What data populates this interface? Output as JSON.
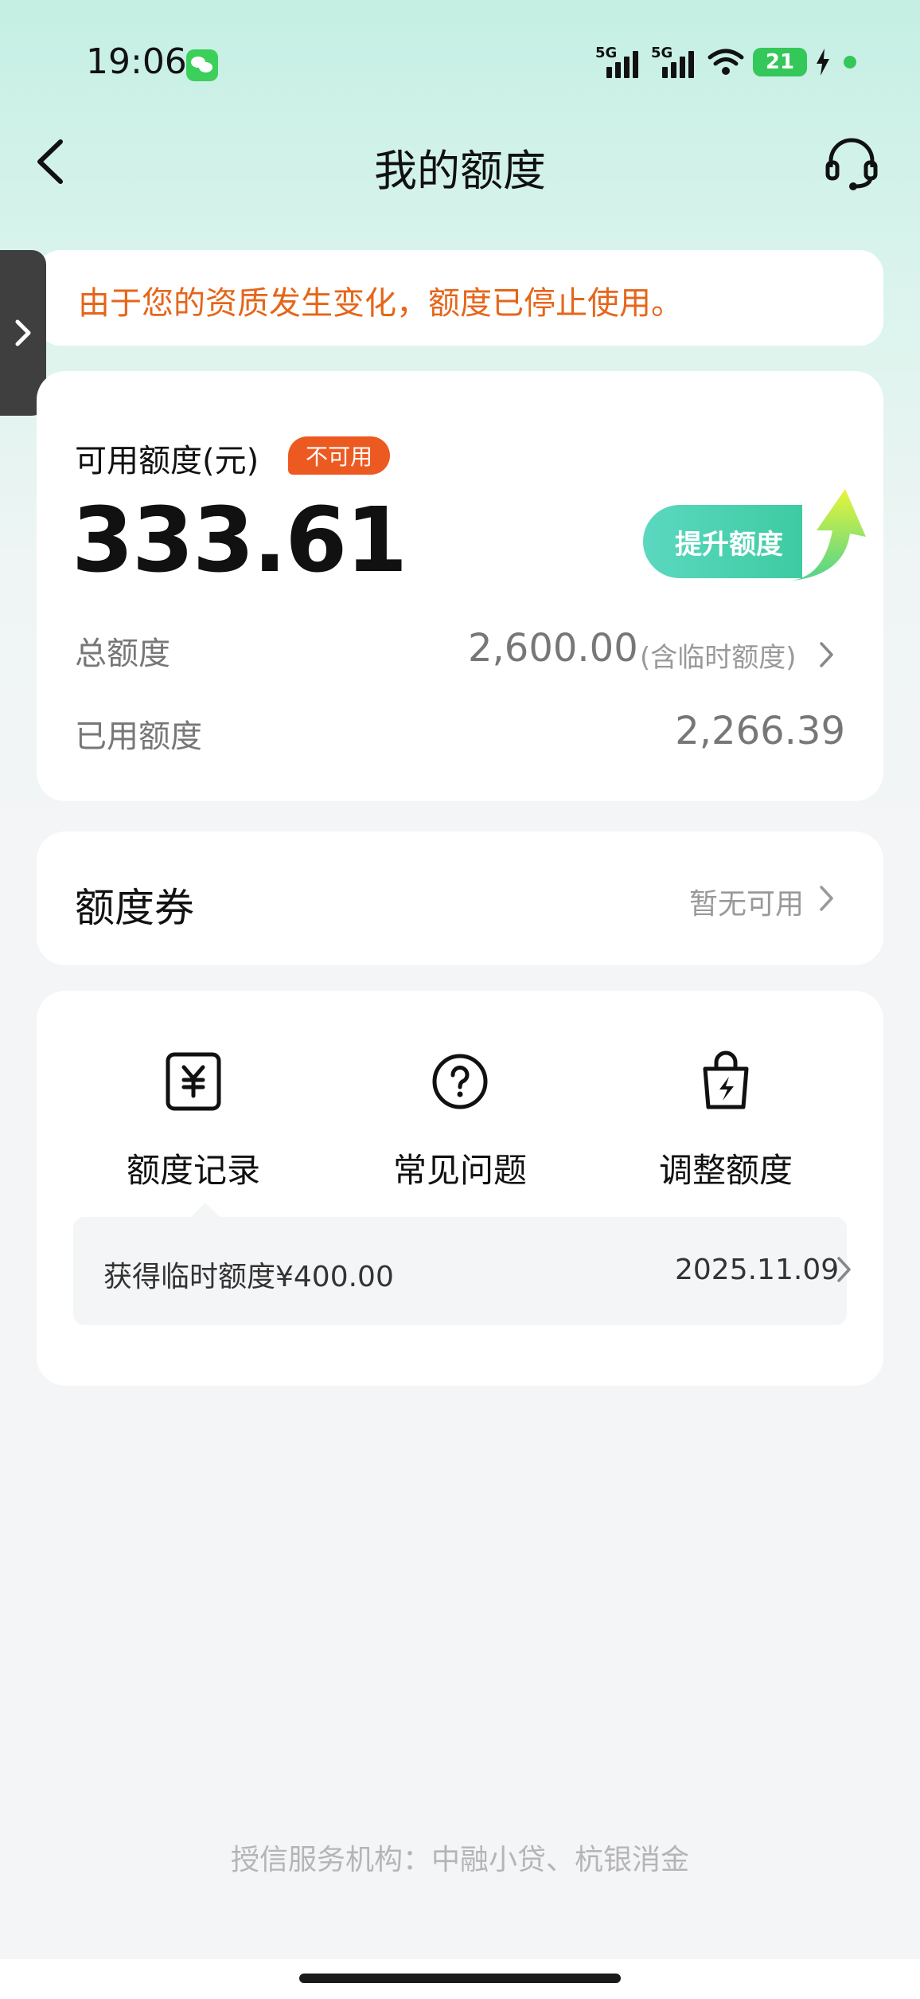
{
  "status_bar": {
    "time": "19:06",
    "signal_1": "5G",
    "signal_2": "5G",
    "battery": "21",
    "icons": [
      "wechat-icon",
      "cellular-icon",
      "wifi-icon",
      "battery-icon",
      "charging-icon"
    ]
  },
  "header": {
    "title": "我的额度",
    "back_icon": "chevron-left-icon",
    "service_icon": "headset-icon"
  },
  "notice": {
    "text": "由于您的资质发生变化，额度已停止使用。"
  },
  "credit": {
    "available_label": "可用额度(元)",
    "status_badge": "不可用",
    "available_amount": "333.61",
    "raise_button": "提升额度",
    "total_label": "总额度",
    "total_value": "2,600.00",
    "total_note": "(含临时额度)",
    "used_label": "已用额度",
    "used_value": "2,266.39"
  },
  "coupon": {
    "title": "额度券",
    "status": "暂无可用"
  },
  "actions": {
    "items": [
      {
        "label": "额度记录",
        "icon": "yen-document-icon"
      },
      {
        "label": "常见问题",
        "icon": "question-circle-icon"
      },
      {
        "label": "调整额度",
        "icon": "bolt-bag-icon"
      }
    ],
    "latest_record": {
      "text": "获得临时额度¥400.00",
      "date": "2025.11.09"
    }
  },
  "footer": {
    "institutions": "授信服务机构：中融小贷、杭银消金"
  },
  "colors": {
    "notice_text": "#e5661a",
    "badge": "#ec5a21",
    "accent_green": "#3ecba2",
    "header_bg": "#c5efe4"
  }
}
